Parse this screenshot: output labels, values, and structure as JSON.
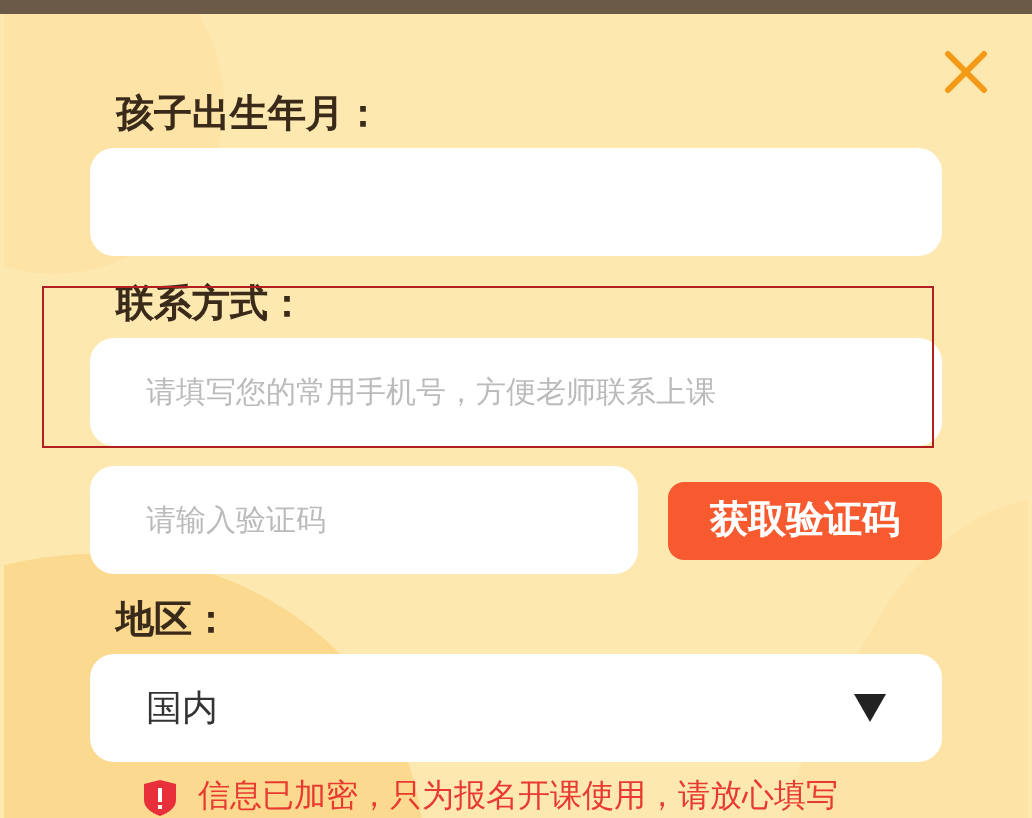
{
  "fields": [
    {
      "kind": "text",
      "label": "孩子出生年月：",
      "highlighted": false
    },
    {
      "kind": "text",
      "label": "联系方式：",
      "placeholder": "请填写您的常用手机号，方便老师联系上课",
      "highlighted": true
    },
    {
      "kind": "code",
      "placeholder": "请输入验证码",
      "button": "获取验证码",
      "highlighted": false
    },
    {
      "kind": "select",
      "label": "地区：",
      "value": "国内",
      "highlighted": false
    }
  ],
  "notice": "信息已加密，只为报名开课使用，请放心填写"
}
